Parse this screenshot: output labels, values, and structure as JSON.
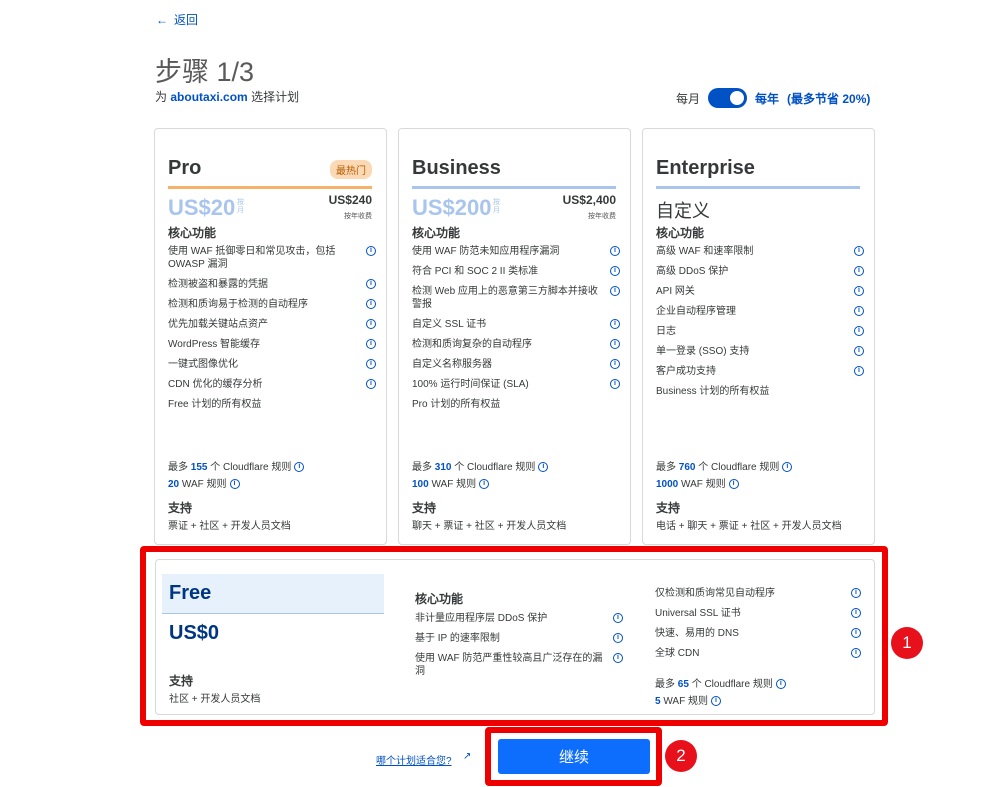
{
  "back": {
    "arrow": "←",
    "label": "返回"
  },
  "header": {
    "title": "步骤 1/3",
    "subtitle_prefix": "为",
    "domain": "aboutaxi.com",
    "subtitle_suffix": "选择计划"
  },
  "billing": {
    "monthly": "每月",
    "yearly": "每年",
    "savings": "(最多节省 20%)",
    "yearly_selected": true
  },
  "colors": {
    "accent": "#0051c3",
    "pro_rule": "#f6b26b",
    "business_rule": "#a9c5ee",
    "highlight": "#ee0000"
  },
  "plans": [
    {
      "name": "Pro",
      "badge": "最热门",
      "price": "US$20",
      "per": "按月",
      "yearly_price": "US$240",
      "yearly_note": "按年收费",
      "core_title": "核心功能",
      "features": [
        "使用 WAF 抵御零日和常见攻击，包括 OWASP 漏洞",
        "检测被盗和暴露的凭据",
        "检测和质询易于检测的自动程序",
        "优先加载关键站点资产",
        "WordPress 智能缓存",
        "一键式图像优化",
        "CDN 优化的缓存分析"
      ],
      "includes": "Free 计划的所有权益",
      "rules_prefix": "最多",
      "rules_count": "155",
      "rules_suffix": "个 Cloudflare 规则",
      "waf_count": "20",
      "waf_label": "WAF 规则",
      "support_title": "支持",
      "support_text": "票证 + 社区 + 开发人员文档"
    },
    {
      "name": "Business",
      "price": "US$200",
      "per": "按月",
      "yearly_price": "US$2,400",
      "yearly_note": "按年收费",
      "core_title": "核心功能",
      "features": [
        "使用 WAF 防范未知应用程序漏洞",
        "符合 PCI 和 SOC 2 II 类标准",
        "检测 Web 应用上的恶意第三方脚本并接收警报",
        "自定义 SSL 证书",
        "检测和质询复杂的自动程序",
        "自定义名称服务器",
        "100% 运行时间保证 (SLA)"
      ],
      "includes": "Pro 计划的所有权益",
      "rules_prefix": "最多",
      "rules_count": "310",
      "rules_suffix": "个 Cloudflare 规则",
      "waf_count": "100",
      "waf_label": "WAF 规则",
      "support_title": "支持",
      "support_text": "聊天 + 票证 + 社区 + 开发人员文档"
    },
    {
      "name": "Enterprise",
      "custom_price": "自定义",
      "core_title": "核心功能",
      "features": [
        "高级 WAF 和速率限制",
        "高级 DDoS 保护",
        "API 网关",
        "企业自动程序管理",
        "日志",
        "单一登录 (SSO) 支持",
        "客户成功支持"
      ],
      "includes": "Business 计划的所有权益",
      "rules_prefix": "最多",
      "rules_count": "760",
      "rules_suffix": "个 Cloudflare 规则",
      "waf_count": "1000",
      "waf_label": "WAF 规则",
      "support_title": "支持",
      "support_text": "电话 + 聊天 + 票证 + 社区 + 开发人员文档"
    }
  ],
  "free": {
    "name": "Free",
    "price": "US$0",
    "support_title": "支持",
    "support_text": "社区 + 开发人员文档",
    "core_title": "核心功能",
    "features_left": [
      "非计量应用程序层 DDoS 保护",
      "基于 IP 的速率限制",
      "使用 WAF 防范严重性较高且广泛存在的漏洞"
    ],
    "features_right": [
      "仅检测和质询常见自动程序",
      "Universal SSL 证书",
      "快速、易用的 DNS",
      "全球 CDN"
    ],
    "rules_prefix": "最多",
    "rules_count": "65",
    "rules_suffix": "个 Cloudflare 规则",
    "waf_count": "5",
    "waf_label": "WAF 规则"
  },
  "footer": {
    "help_link": "哪个计划适合您?",
    "continue": "继续"
  },
  "annotations": {
    "one": "1",
    "two": "2"
  },
  "icons": {
    "info": "i",
    "external": "↗"
  }
}
